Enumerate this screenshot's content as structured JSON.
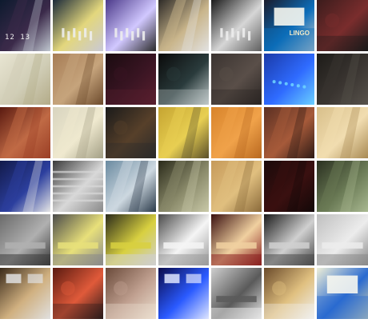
{
  "mosaic": {
    "rows": 6,
    "columns": 7,
    "tiles": [
      {
        "scene": "scoreboard-lanes",
        "colors": [
          "#0d1a2e",
          "#3b2a4a",
          "#c0c7d0"
        ]
      },
      {
        "scene": "pinsetter-bright",
        "colors": [
          "#1b2a3a",
          "#e3d77d",
          "#c9c9d6"
        ]
      },
      {
        "scene": "pinsetter-purple",
        "colors": [
          "#4c3a8a",
          "#d1c8ff",
          "#2a2a2a"
        ]
      },
      {
        "scene": "lane-gutter-pins",
        "colors": [
          "#2e2b28",
          "#c9b58b",
          "#e2e2e2"
        ]
      },
      {
        "scene": "pins-lights",
        "colors": [
          "#1b1b1b",
          "#d6d6d6",
          "#5f5f5f"
        ]
      },
      {
        "scene": "bingo-sign",
        "colors": [
          "#1b1b2b",
          "#0c6db9",
          "#cfcfcf"
        ]
      },
      {
        "scene": "dark-red",
        "colors": [
          "#3b1c1c",
          "#7a2d2d",
          "#1b1b1b"
        ]
      },
      {
        "scene": "lane-light",
        "colors": [
          "#e8e5d2",
          "#d0cdb6",
          "#b3ab88"
        ]
      },
      {
        "scene": "lane-wood",
        "colors": [
          "#a67c55",
          "#c6a47c",
          "#6c4a2c"
        ]
      },
      {
        "scene": "dark-brown",
        "colors": [
          "#1a0b10",
          "#3a1523",
          "#5a1f2f"
        ]
      },
      {
        "scene": "gutter-dark",
        "colors": [
          "#0a0a0a",
          "#2a3b3c",
          "#c0c9c9"
        ]
      },
      {
        "scene": "brown-gray",
        "colors": [
          "#3a3330",
          "#5a4f49",
          "#2a2523"
        ]
      },
      {
        "scene": "blue-neon",
        "colors": [
          "#1a3aa8",
          "#2f6bff",
          "#6bd0ff"
        ]
      },
      {
        "scene": "dark-lane",
        "colors": [
          "#1d1b18",
          "#3a3531",
          "#57524b"
        ]
      },
      {
        "scene": "red-lane",
        "colors": [
          "#5a1a10",
          "#c06a45",
          "#9a3e25"
        ]
      },
      {
        "scene": "pale-lane",
        "colors": [
          "#d8d4bf",
          "#efe9cf",
          "#a39f85"
        ]
      },
      {
        "scene": "dark-shine",
        "colors": [
          "#1a1a1a",
          "#57402a",
          "#2a2a2a"
        ]
      },
      {
        "scene": "yellow-lane",
        "colors": [
          "#c5a431",
          "#e8cf52",
          "#5a4f2a"
        ]
      },
      {
        "scene": "orange-blur",
        "colors": [
          "#d8842b",
          "#f0a24a",
          "#b8681f"
        ]
      },
      {
        "scene": "brown-lanes",
        "colors": [
          "#5a2f22",
          "#a65a3a",
          "#2e1a15"
        ]
      },
      {
        "scene": "light-wood",
        "colors": [
          "#d8bf8a",
          "#f1ddb0",
          "#a88a54"
        ]
      },
      {
        "scene": "person-lane",
        "colors": [
          "#121a4a",
          "#2c3f9e",
          "#e6e6e6"
        ]
      },
      {
        "scene": "seating-rows",
        "colors": [
          "#3a3a3a",
          "#d8d8d8",
          "#8a8a8a"
        ]
      },
      {
        "scene": "blue-lanes",
        "colors": [
          "#6a8aa0",
          "#cdd8e0",
          "#2a3a4a"
        ]
      },
      {
        "scene": "olive-lanes",
        "colors": [
          "#2a2a1a",
          "#8a8a6a",
          "#c9c9a8"
        ]
      },
      {
        "scene": "wood-blur",
        "colors": [
          "#c69a5a",
          "#e0bf7f",
          "#8a6a3a"
        ]
      },
      {
        "scene": "dark-red-blur",
        "colors": [
          "#1a0a0a",
          "#3a1010",
          "#120808"
        ]
      },
      {
        "scene": "green-lanes",
        "colors": [
          "#2a3020",
          "#6a7a55",
          "#a8b890"
        ]
      },
      {
        "scene": "ceiling-gray",
        "colors": [
          "#6a6a6a",
          "#b0b0b0",
          "#3a3a3a"
        ]
      },
      {
        "scene": "ceiling-yellow-light",
        "colors": [
          "#4a4a4a",
          "#e8e07a",
          "#8a8a8a"
        ]
      },
      {
        "scene": "ceiling-yellow-panel",
        "colors": [
          "#2a2a1a",
          "#d8d040",
          "#cfcfcf"
        ]
      },
      {
        "scene": "ceiling-white-light",
        "colors": [
          "#4a4a4a",
          "#f5f5f5",
          "#9a9a9a"
        ]
      },
      {
        "scene": "ceiling-red-light",
        "colors": [
          "#3a1010",
          "#f0d0a0",
          "#8a2020"
        ]
      },
      {
        "scene": "ceiling-dark",
        "colors": [
          "#1a1a1a",
          "#d0d0d0",
          "#4a4a4a"
        ]
      },
      {
        "scene": "ceiling-white",
        "colors": [
          "#bfbfbf",
          "#ececec",
          "#8a8a8a"
        ]
      },
      {
        "scene": "hall-tv",
        "colors": [
          "#3a2a1a",
          "#d0b080",
          "#e0e0e0"
        ]
      },
      {
        "scene": "hall-red",
        "colors": [
          "#5a1a10",
          "#e05a3a",
          "#2a1a1a"
        ]
      },
      {
        "scene": "abstract-tan",
        "colors": [
          "#6a4a3a",
          "#c0a090",
          "#ece0d0"
        ]
      },
      {
        "scene": "blue-screens",
        "colors": [
          "#0a0a4a",
          "#2a5aff",
          "#dfe6ff"
        ]
      },
      {
        "scene": "ceiling-camera",
        "colors": [
          "#cfcfcf",
          "#5a5a5a",
          "#e5e5e5"
        ]
      },
      {
        "scene": "hall-lights",
        "colors": [
          "#6a4a2a",
          "#e0c080",
          "#f0f0f0"
        ]
      },
      {
        "scene": "sign-blue",
        "colors": [
          "#f0f0d8",
          "#2a6ad0",
          "#d8d8b0"
        ]
      }
    ],
    "scoreboard_text": "12  13",
    "sign_text": "LINGO"
  }
}
